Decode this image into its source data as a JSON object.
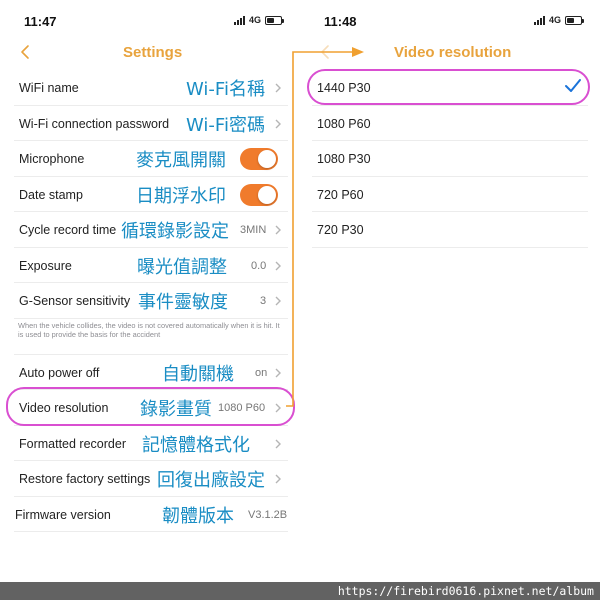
{
  "left_screen": {
    "status_time": "11:47",
    "network": "4G",
    "battery_level": 0.5,
    "title": "Settings",
    "items": [
      {
        "label": "WiFi name",
        "zh": "Wi-Fi名稱",
        "value": "",
        "control": "chevron"
      },
      {
        "label": "Wi-Fi connection password",
        "zh": "Wi-Fi密碼",
        "value": "",
        "control": "chevron"
      },
      {
        "label": "Microphone",
        "zh": "麥克風開關",
        "value": "",
        "control": "toggle",
        "on": true
      },
      {
        "label": "Date stamp",
        "zh": "日期浮水印",
        "value": "",
        "control": "toggle",
        "on": true
      },
      {
        "label": "Cycle record time",
        "zh": "循環錄影設定",
        "value": "3MIN",
        "control": "chevron"
      },
      {
        "label": "Exposure",
        "zh": "曝光值調整",
        "value": "0.0",
        "control": "chevron"
      },
      {
        "label": "G-Sensor sensitivity",
        "zh": "事件靈敏度",
        "value": "3",
        "control": "chevron"
      },
      {
        "label": "Auto power off",
        "zh": "自動關機",
        "value": "on",
        "control": "chevron"
      },
      {
        "label": "Video resolution",
        "zh": "錄影畫質",
        "value": "1080 P60",
        "control": "chevron",
        "highlighted": true
      },
      {
        "label": "Formatted recorder",
        "zh": "記憶體格式化",
        "value": "",
        "control": "chevron"
      },
      {
        "label": "Restore factory settings",
        "zh": "回復出廠設定",
        "value": "",
        "control": "chevron"
      },
      {
        "label": "Firmware version",
        "zh": "韌體版本",
        "value": "V3.1.2B",
        "control": "none"
      }
    ],
    "gsensor_note": "When the vehicle collides, the video is not covered automatically when it is hit. It is used to provide the basis for the accident"
  },
  "right_screen": {
    "status_time": "11:48",
    "network": "4G",
    "battery_level": 0.5,
    "title": "Video resolution",
    "options": [
      {
        "label": "1440 P30",
        "selected": true
      },
      {
        "label": "1080 P60",
        "selected": false
      },
      {
        "label": "1080 P30",
        "selected": false
      },
      {
        "label": "720 P60",
        "selected": false
      },
      {
        "label": "720 P30",
        "selected": false
      }
    ]
  },
  "colors": {
    "accent": "#e8a33d",
    "toggle_on": "#f07b2c",
    "annotation_text": "#1a8dc4",
    "highlight_ring": "#d94fd1",
    "arrow": "#f0a030",
    "check": "#1a73d9"
  },
  "icons": {
    "back": "chevron-left-icon",
    "row": "chevron-right-icon",
    "selected": "checkmark-icon",
    "signal": "signal-icon",
    "battery": "battery-icon"
  },
  "footer": {
    "url": "https://firebird0616.pixnet.net/album"
  }
}
